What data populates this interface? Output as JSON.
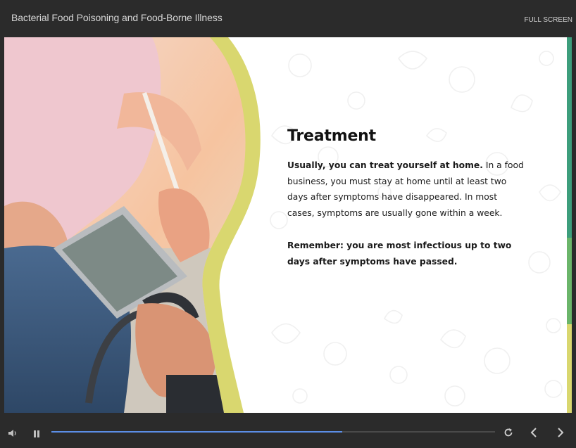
{
  "header": {
    "course_title": "Bacterial Food Poisoning and Food-Borne Illness",
    "fullscreen_label": "FULL SCREEN"
  },
  "slide": {
    "heading": "Treatment",
    "paragraph1_bold": "Usually, you can treat yourself at home.",
    "paragraph1_rest": " In a food business, you must stay at home until at least two days after symptoms have disappeared. In most cases, symptoms are usually gone within a week.",
    "paragraph2_bold": "Remember: you are most infectious up to two days after symptoms have passed."
  },
  "player": {
    "progress_fraction": 0.656,
    "icons": {
      "volume": "volume-icon",
      "pause": "pause-icon",
      "replay": "replay-icon",
      "prev": "chevron-left-icon",
      "next": "chevron-right-icon"
    }
  },
  "colors": {
    "accent_yellow": "#d9d76f",
    "strip_teal": "#3d9e7c",
    "strip_green": "#6bb56a",
    "strip_yellow": "#d9d76f",
    "progress_blue": "#5b8ee6"
  }
}
